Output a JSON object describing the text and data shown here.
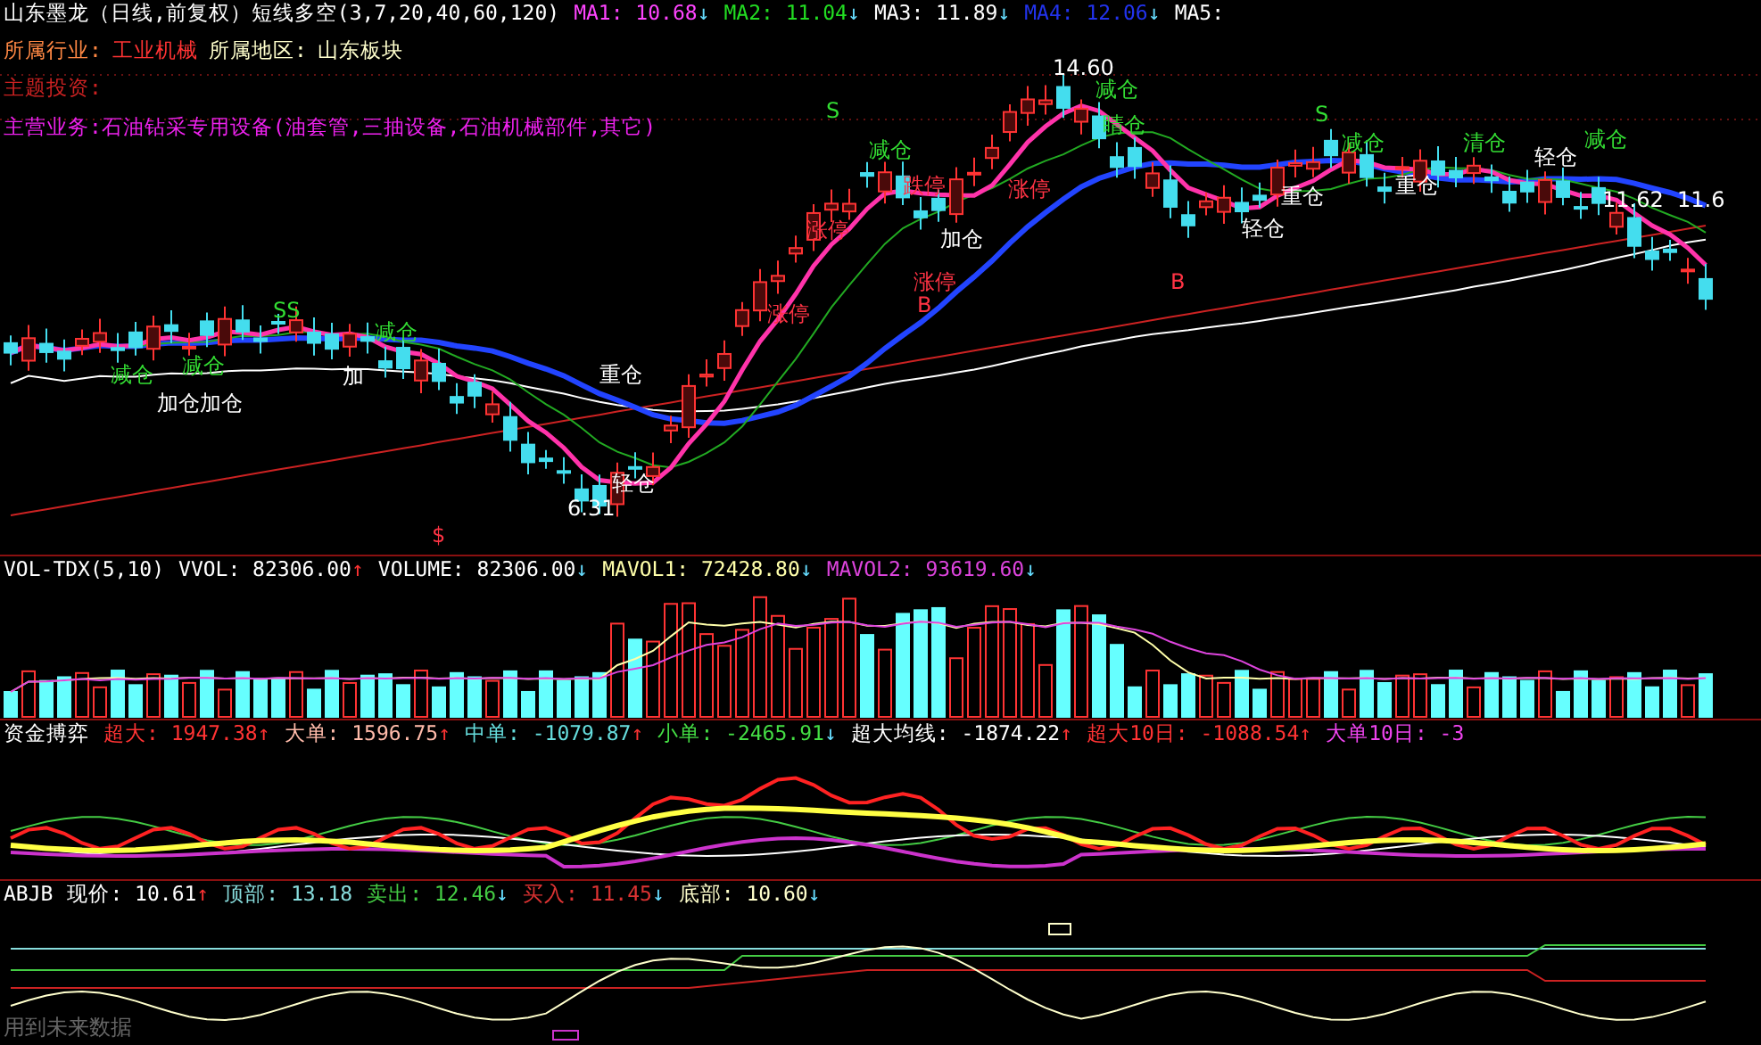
{
  "title_line": {
    "title": "山东墨龙（日线,前复权）短线多空(3,7,20,40,60,120)",
    "indicators": [
      {
        "text": "MA1: 10.68",
        "color": "#ff44ff",
        "arrow": {
          "text": "↓",
          "color": "#66ddff"
        }
      },
      {
        "text": "MA2: 11.04",
        "color": "#22dd22",
        "arrow": {
          "text": "↓",
          "color": "#66ddff"
        }
      },
      {
        "text": "MA3: 11.89",
        "color": "#ffffff",
        "arrow": {
          "text": "↓",
          "color": "#66ddff"
        }
      },
      {
        "text": "MA4: 12.06",
        "color": "#2233ee",
        "arrow": {
          "text": "↓",
          "color": "#66ddff"
        }
      },
      {
        "text": "MA5:",
        "color": "#ffffff"
      }
    ]
  },
  "info_lines": [
    {
      "parts": [
        {
          "text": "所属行业:",
          "color": "#ff8844"
        },
        {
          "text": "工业机械",
          "color": "#ff3333"
        },
        {
          "text": "所属地区:",
          "color": "#ffffcc"
        },
        {
          "text": "山东板块",
          "color": "#ffffcc"
        }
      ]
    },
    {
      "parts": [
        {
          "text": "主题投资:",
          "color": "#cc2222"
        }
      ]
    },
    {
      "parts": [
        {
          "text": "主营业务:石油钻采专用设备(油套管,三抽设备,石油机械部件,其它)",
          "color": "#ee22ee"
        }
      ]
    }
  ],
  "signals": [
    {
      "text": "减仓",
      "kind": "sell"
    },
    {
      "text": "加仓加仓",
      "kind": "position"
    },
    {
      "text": "减仓",
      "kind": "sell"
    },
    {
      "text": "SS",
      "kind": "sell"
    },
    {
      "text": "减仓",
      "kind": "sell"
    },
    {
      "text": "加",
      "kind": "position"
    },
    {
      "text": "6.31",
      "kind": "price"
    },
    {
      "text": "轻仓",
      "kind": "position"
    },
    {
      "text": "重仓",
      "kind": "position"
    },
    {
      "text": "涨停",
      "kind": "limit"
    },
    {
      "text": "加仓",
      "kind": "position"
    },
    {
      "text": "涨停",
      "kind": "limit"
    },
    {
      "text": "B",
      "kind": "limit"
    },
    {
      "text": "涨停",
      "kind": "limit"
    },
    {
      "text": "14.60",
      "kind": "price"
    },
    {
      "text": "减仓",
      "kind": "sell"
    },
    {
      "text": "睛仓",
      "kind": "sell"
    },
    {
      "text": "减仓",
      "kind": "sell"
    },
    {
      "text": "跌停",
      "kind": "limit"
    },
    {
      "text": "轻仓",
      "kind": "position"
    },
    {
      "text": "重仓",
      "kind": "position"
    },
    {
      "text": "B",
      "kind": "limit"
    },
    {
      "text": "S",
      "kind": "sell"
    },
    {
      "text": "减仓",
      "kind": "sell"
    },
    {
      "text": "重仓",
      "kind": "position"
    },
    {
      "text": "清仓",
      "kind": "sell"
    },
    {
      "text": "减仓",
      "kind": "sell"
    },
    {
      "text": "轻仓",
      "kind": "position"
    },
    {
      "text": "11.62",
      "kind": "price"
    },
    {
      "text": "11.6",
      "kind": "price"
    },
    {
      "text": "$",
      "kind": "limit"
    },
    {
      "text": "S",
      "kind": "sell"
    },
    {
      "text": "涨停",
      "kind": "limit"
    }
  ],
  "volume_panel": {
    "title": "VOL-TDX(5,10)",
    "indicators": [
      {
        "text": "VVOL: 82306.00",
        "color": "#ffffff",
        "arrow": {
          "text": "↑",
          "color": "#ff3333"
        }
      },
      {
        "text": "VOLUME: 82306.00",
        "color": "#ffffff",
        "arrow": {
          "text": "↓",
          "color": "#66ddff"
        }
      },
      {
        "text": "MAVOL1: 72428.80",
        "color": "#ffffaa",
        "arrow": {
          "text": "↓",
          "color": "#66ddff"
        }
      },
      {
        "text": "MAVOL2: 93619.60",
        "color": "#dd44dd",
        "arrow": {
          "text": "↓",
          "color": "#66ddff"
        }
      }
    ]
  },
  "fund_panel": {
    "title": "资金搏弈",
    "indicators": [
      {
        "text": "超大: 1947.38",
        "color": "#ff3333",
        "arrow": {
          "text": "↑",
          "color": "#ff3333"
        }
      },
      {
        "text": "大单: 1596.75",
        "color": "#ffbbaa",
        "arrow": {
          "text": "↑",
          "color": "#ff3333"
        }
      },
      {
        "text": "中单: -1079.87",
        "color": "#66dddd",
        "arrow": {
          "text": "↑",
          "color": "#ff3333"
        }
      },
      {
        "text": "小单: -2465.91",
        "color": "#44dd44",
        "arrow": {
          "text": "↓",
          "color": "#66ddff"
        }
      },
      {
        "text": "超大均线: -1874.22",
        "color": "#ffffff",
        "arrow": {
          "text": "↑",
          "color": "#ff3333"
        }
      },
      {
        "text": "超大10日: -1088.54",
        "color": "#ff3333",
        "arrow": {
          "text": "↑",
          "color": "#ff3333"
        }
      },
      {
        "text": "大单10日: -3",
        "color": "#ee44ee"
      }
    ]
  },
  "abjb_panel": {
    "title": "ABJB",
    "indicators": [
      {
        "text": "现价: 10.61",
        "color": "#ffffff",
        "arrow": {
          "text": "↑",
          "color": "#ff3333"
        }
      },
      {
        "text": "顶部: 13.18",
        "color": "#88dddd"
      },
      {
        "text": "卖出: 12.46",
        "color": "#44cc44",
        "arrow": {
          "text": "↓",
          "color": "#66ddff"
        }
      },
      {
        "text": "买入: 11.45",
        "color": "#dd3333",
        "arrow": {
          "text": "↓",
          "color": "#66ddff"
        }
      },
      {
        "text": "底部: 10.60",
        "color": "#ffffcc",
        "arrow": {
          "text": "↓",
          "color": "#66ddff"
        }
      }
    ],
    "note": "用到未来数据"
  }
}
